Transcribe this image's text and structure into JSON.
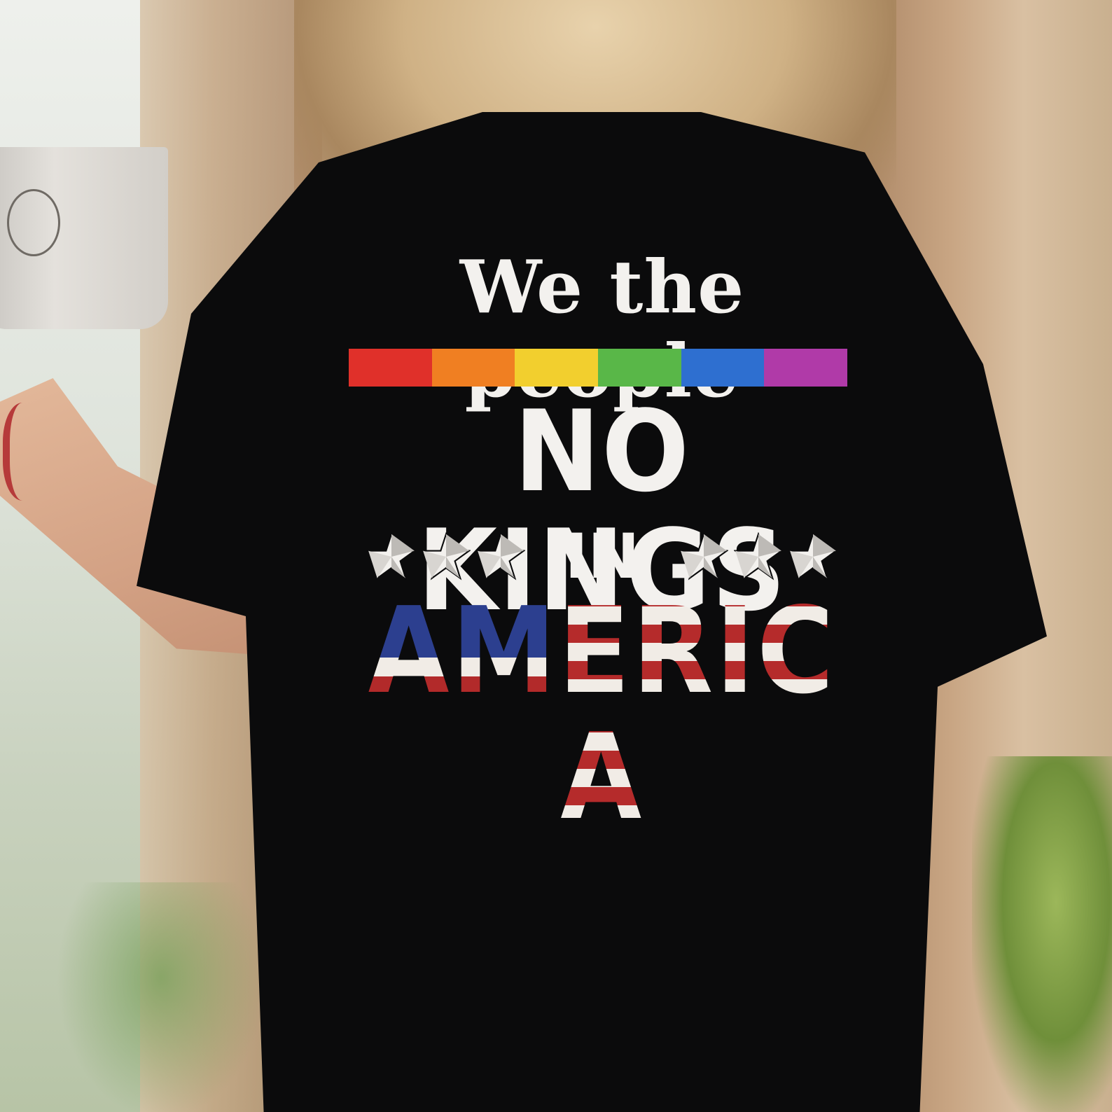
{
  "shirt_print": {
    "tagline": "We the people",
    "headline": "NO KINGS",
    "connector": "IN",
    "country_letters": [
      "A",
      "M",
      "E",
      "R",
      "I",
      "C",
      "A"
    ]
  },
  "icons": {
    "star": "star-icon",
    "mug_doodle": "cat-doodle-icon"
  },
  "colors": {
    "shirt": "#0b0b0c",
    "print_text": "#f3f1ee",
    "rainbow": [
      "#e0302a",
      "#f07f22",
      "#f2cf2e",
      "#59b748",
      "#2e6fd0",
      "#b03aa8"
    ],
    "flag_blue": "#2c3f8f",
    "flag_red": "#b52b2b"
  },
  "stars": {
    "left_count": 3,
    "right_count": 3
  }
}
